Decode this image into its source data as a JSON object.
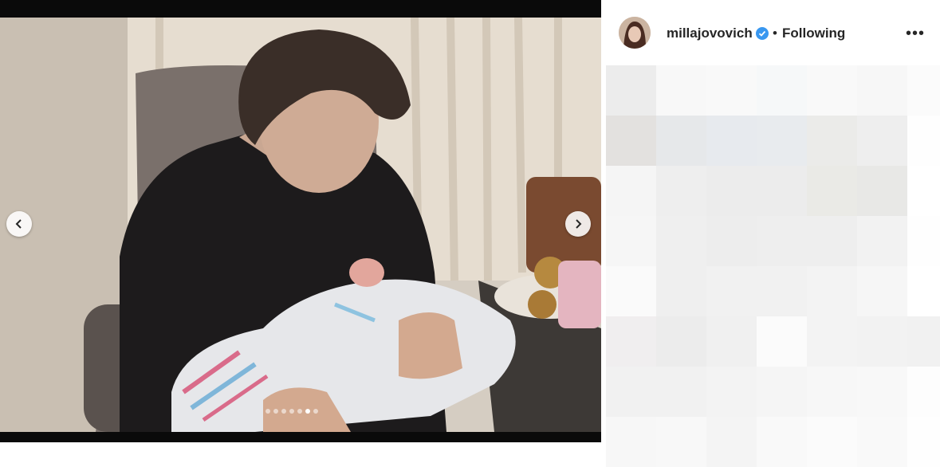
{
  "post": {
    "username": "millajovovich",
    "separator": "•",
    "follow_status": "Following",
    "more_label": "•••",
    "slide_count": 7,
    "active_slide": 6
  },
  "icons": {
    "verified": "verified-badge-icon",
    "prev": "chevron-left-icon",
    "next": "chevron-right-icon",
    "more": "more-options-icon"
  },
  "colors": {
    "verified_blue": "#3897f0",
    "text": "#262626"
  }
}
